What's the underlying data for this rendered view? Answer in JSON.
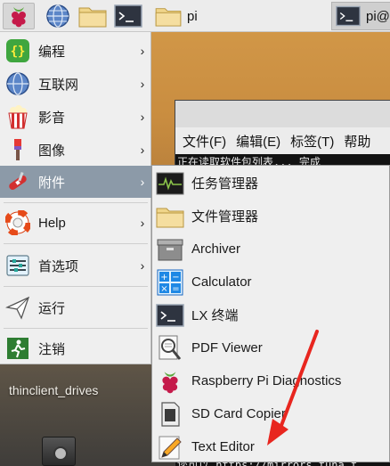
{
  "taskbar": {
    "menu_icon": "raspberry-icon",
    "launchers": [
      {
        "name": "browser",
        "icon": "globe-icon"
      },
      {
        "name": "files",
        "icon": "folder-icon"
      },
      {
        "name": "terminal",
        "icon": "terminal-icon"
      }
    ],
    "tasks": [
      {
        "label": "pi",
        "icon": "folder-icon"
      },
      {
        "label": "pi@r",
        "icon": "terminal-icon",
        "active": true
      }
    ]
  },
  "terminal": {
    "menubar": [
      "文件(F)",
      "编辑(E)",
      "标签(T)",
      "帮助"
    ],
    "output_line": "正在读取软件包列表... 完成",
    "bottom_line": "您可以 https://mirrors.tuna.t"
  },
  "main_menu": {
    "items": [
      {
        "label": "编程",
        "icon": "braces-icon",
        "has_submenu": true
      },
      {
        "label": "互联网",
        "icon": "globe-icon",
        "has_submenu": true
      },
      {
        "label": "影音",
        "icon": "popcorn-icon",
        "has_submenu": true
      },
      {
        "label": "图像",
        "icon": "paintbrush-icon",
        "has_submenu": true
      },
      {
        "label": "附件",
        "icon": "swiss-knife-icon",
        "has_submenu": true,
        "active": true
      },
      {
        "label": "Help",
        "icon": "lifebuoy-icon",
        "has_submenu": true
      },
      {
        "label": "首选项",
        "icon": "preferences-icon",
        "has_submenu": true
      },
      {
        "label": "运行",
        "icon": "paper-plane-icon",
        "has_submenu": false
      },
      {
        "label": "注销",
        "icon": "exit-icon",
        "has_submenu": false
      }
    ],
    "arrow_glyph": "›"
  },
  "sub_menu": {
    "items": [
      {
        "label": "任务管理器",
        "icon": "task-manager-icon"
      },
      {
        "label": "文件管理器",
        "icon": "folder-icon"
      },
      {
        "label": "Archiver",
        "icon": "archive-icon"
      },
      {
        "label": "Calculator",
        "icon": "calculator-icon"
      },
      {
        "label": "LX 终端",
        "icon": "terminal-icon"
      },
      {
        "label": "PDF Viewer",
        "icon": "magnifier-icon"
      },
      {
        "label": "Raspberry Pi Diagnostics",
        "icon": "raspberry-icon"
      },
      {
        "label": "SD Card Copier",
        "icon": "sd-card-icon"
      },
      {
        "label": "Text Editor",
        "icon": "pencil-icon"
      }
    ]
  },
  "desktop": {
    "icon_label": "thinclient_drives"
  },
  "colors": {
    "menu_bg": "#efefef",
    "active_bg": "#8c9aa8",
    "annotation": "#e8261f"
  }
}
